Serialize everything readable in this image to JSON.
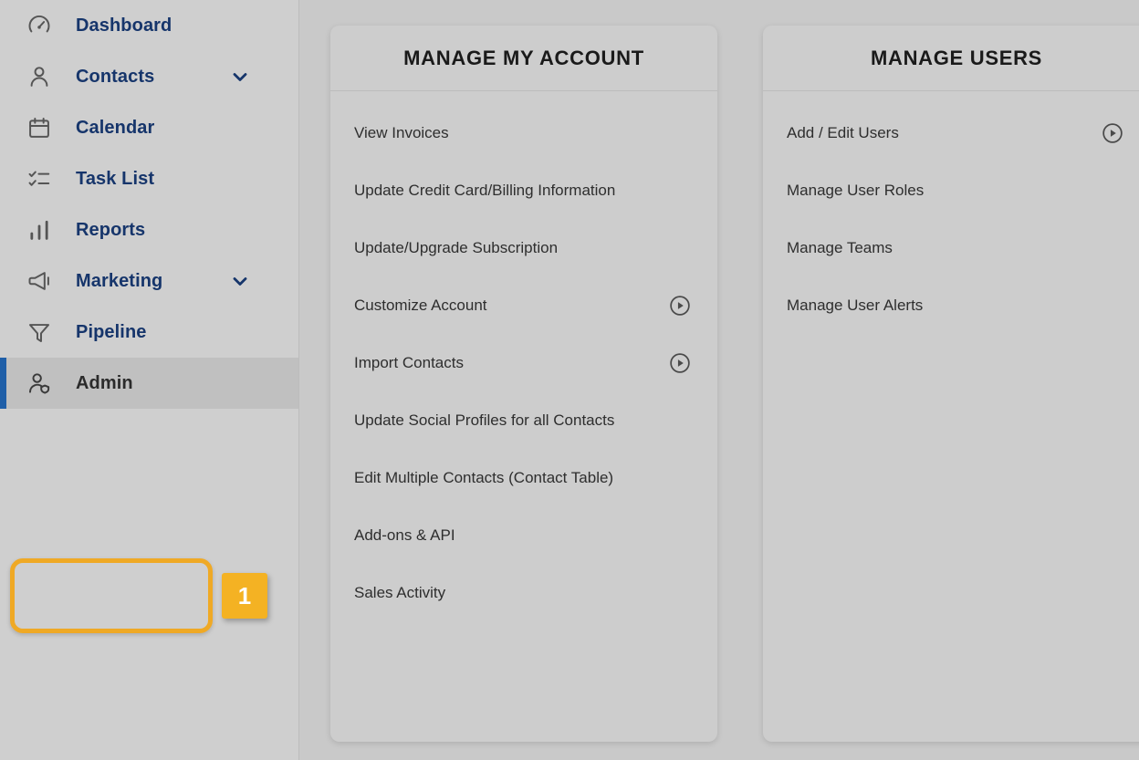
{
  "colors": {
    "page_background": "#c9c9c9",
    "sidebar_background": "#cfcfcf",
    "panel_background": "#cdcdcd",
    "nav_label": "#16356b",
    "highlight_orange": "#efa925",
    "badge_orange": "#f4b223",
    "active_accent_blue": "#1f5fa8",
    "active_row": "#c0c0c0"
  },
  "sidebar": {
    "items": [
      {
        "label": "Dashboard",
        "icon": "gauge-icon",
        "has_chevron": false,
        "active": false
      },
      {
        "label": "Contacts",
        "icon": "person-icon",
        "has_chevron": true,
        "active": false
      },
      {
        "label": "Calendar",
        "icon": "calendar-icon",
        "has_chevron": false,
        "active": false
      },
      {
        "label": "Task List",
        "icon": "checklist-icon",
        "has_chevron": false,
        "active": false
      },
      {
        "label": "Reports",
        "icon": "bar-chart-icon",
        "has_chevron": false,
        "active": false
      },
      {
        "label": "Marketing",
        "icon": "megaphone-icon",
        "has_chevron": true,
        "active": false
      },
      {
        "label": "Pipeline",
        "icon": "funnel-icon",
        "has_chevron": false,
        "active": false
      },
      {
        "label": "Admin",
        "icon": "user-admin-icon",
        "has_chevron": false,
        "active": true
      }
    ]
  },
  "annotation": {
    "step_number": "1",
    "target": "Admin"
  },
  "panels": [
    {
      "title": "MANAGE MY ACCOUNT",
      "items": [
        {
          "label": "View Invoices",
          "has_play": false
        },
        {
          "label": "Update Credit Card/Billing Information",
          "has_play": false
        },
        {
          "label": "Update/Upgrade Subscription",
          "has_play": false
        },
        {
          "label": "Customize Account",
          "has_play": true
        },
        {
          "label": "Import Contacts",
          "has_play": true
        },
        {
          "label": "Update Social Profiles for all Contacts",
          "has_play": false
        },
        {
          "label": "Edit Multiple Contacts (Contact Table)",
          "has_play": false
        },
        {
          "label": "Add-ons & API",
          "has_play": false
        },
        {
          "label": "Sales Activity",
          "has_play": false
        }
      ]
    },
    {
      "title": "MANAGE USERS",
      "items": [
        {
          "label": "Add / Edit Users",
          "has_play": true
        },
        {
          "label": "Manage User Roles",
          "has_play": false
        },
        {
          "label": "Manage Teams",
          "has_play": false
        },
        {
          "label": "Manage User Alerts",
          "has_play": false
        }
      ]
    }
  ]
}
